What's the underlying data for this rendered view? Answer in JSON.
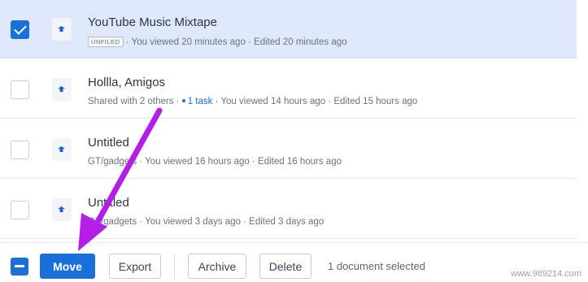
{
  "documents": [
    {
      "title": "YouTube Music Mixtape",
      "badge": "UNFILED",
      "meta": "· You viewed 20 minutes ago · Edited 20 minutes ago",
      "selected": true
    },
    {
      "title": "Hollla, Amigos",
      "meta_prefix": "Shared with 2 others ·",
      "task": "1 task",
      "meta_suffix": "· You viewed 14 hours ago · Edited 15 hours ago",
      "selected": false
    },
    {
      "title": "Untitled",
      "meta": "GT/gadgets · You viewed 16 hours ago · Edited 16 hours ago",
      "selected": false
    },
    {
      "title": "Untitled",
      "meta": "GT/gadgets · You viewed 3 days ago · Edited 3 days ago",
      "selected": false
    }
  ],
  "footer": {
    "move_label": "Move",
    "export_label": "Export",
    "archive_label": "Archive",
    "delete_label": "Delete",
    "status": "1 document selected"
  },
  "watermark": "www.989214.com",
  "icons": {
    "row": "doc-upload-icon",
    "annotation": "purple-arrow"
  },
  "colors": {
    "accent": "#1a6fd8",
    "selected_row": "#dfe8fb",
    "annotation": "#b31fe6"
  }
}
